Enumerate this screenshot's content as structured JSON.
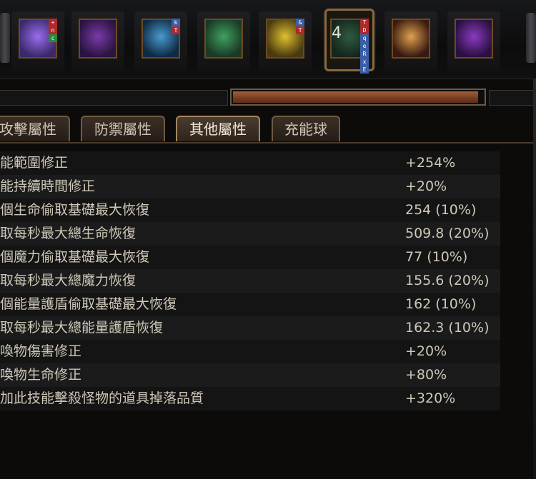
{
  "skill_bar": {
    "skills": [
      {
        "icon": "lightning-figure-icon",
        "colors": [
          "#3a2a6a",
          "#9a6cf0"
        ],
        "tags": [
          "+",
          "n",
          "c"
        ],
        "tag_colors": [
          "#b02a2a",
          "#b02a2a",
          "#2a8a3a"
        ]
      },
      {
        "icon": "purple-fist-icon",
        "colors": [
          "#2a1440",
          "#7a3aa8"
        ],
        "tags": [],
        "tag_colors": []
      },
      {
        "icon": "blue-lightning-runner-icon",
        "colors": [
          "#0f2a44",
          "#4a9ad0"
        ],
        "tags": [
          "k",
          "T"
        ],
        "tag_colors": [
          "#3a5fa8",
          "#b02a2a"
        ]
      },
      {
        "icon": "green-totem-icon",
        "colors": [
          "#1a3a24",
          "#3fa060"
        ],
        "tags": [],
        "tag_colors": []
      },
      {
        "icon": "yellow-runner-icon",
        "colors": [
          "#4a3a10",
          "#e0c030"
        ],
        "tags": [
          "&",
          "T"
        ],
        "tag_colors": [
          "#3a5fa8",
          "#b02a2a"
        ]
      },
      {
        "icon": "green-rune-gem-icon",
        "colors": [
          "#14261c",
          "#2e5a40"
        ],
        "tags": [
          "T",
          "D",
          "q",
          "e",
          "R",
          "x",
          "E"
        ],
        "tag_colors": [
          "#b02a2a",
          "#b02a2a",
          "#3a5fa8",
          "#3a5fa8",
          "#3a5fa8",
          "#3a5fa8",
          "#3a5fa8"
        ],
        "level": "4",
        "active": true
      },
      {
        "icon": "candles-icon",
        "colors": [
          "#3a1a10",
          "#e0a050"
        ],
        "tags": [],
        "tag_colors": []
      },
      {
        "icon": "purple-orb-fist-icon",
        "colors": [
          "#2a1040",
          "#8a3ac0"
        ],
        "tags": [],
        "tag_colors": []
      }
    ]
  },
  "progress": {
    "fill_fraction": 0.98,
    "fill_color": "#8a4a2a"
  },
  "tabs": [
    {
      "label": "攻擊屬性",
      "active": false
    },
    {
      "label": "防禦屬性",
      "active": false
    },
    {
      "label": "其他屬性",
      "active": true
    },
    {
      "label": "充能球",
      "active": false
    }
  ],
  "stats": [
    {
      "name": "能範圍修正",
      "value": "+254%"
    },
    {
      "name": "能持續時間修正",
      "value": "+20%"
    },
    {
      "name": "個生命偷取基礎最大恢復",
      "value": "254 (10%)"
    },
    {
      "name": "取每秒最大總生命恢復",
      "value": "509.8 (20%)"
    },
    {
      "name": "個魔力偷取基礎最大恢復",
      "value": "77 (10%)"
    },
    {
      "name": "取每秒最大總魔力恢復",
      "value": "155.6 (20%)"
    },
    {
      "name": "個能量護盾偷取基礎最大恢復",
      "value": "162 (10%)"
    },
    {
      "name": "取每秒最大總能量護盾恢復",
      "value": "162.3 (10%)"
    },
    {
      "name": "喚物傷害修正",
      "value": "+20%"
    },
    {
      "name": "喚物生命修正",
      "value": "+80%"
    },
    {
      "name": "加此技能擊殺怪物的道具掉落品質",
      "value": "+320%"
    }
  ]
}
